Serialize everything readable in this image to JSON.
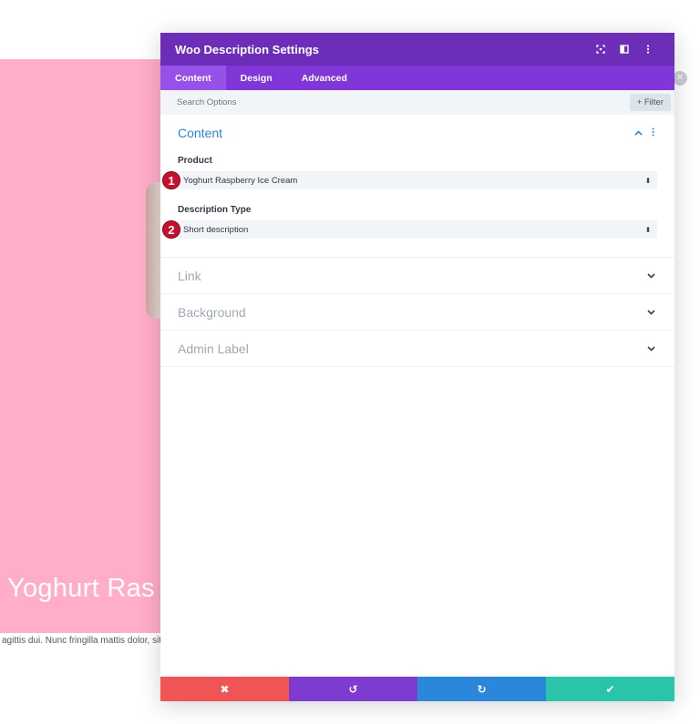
{
  "background": {
    "title": "Yoghurt Ras",
    "text": "agittis dui. Nunc fringilla mattis dolor, sit"
  },
  "modal": {
    "title": "Woo Description Settings",
    "header_icons": [
      "fullscreen-icon",
      "columns-icon",
      "kebab-icon"
    ]
  },
  "tabs": [
    {
      "label": "Content",
      "active": true
    },
    {
      "label": "Design",
      "active": false
    },
    {
      "label": "Advanced",
      "active": false
    }
  ],
  "search": {
    "placeholder": "Search Options",
    "filter_label": "+ Filter"
  },
  "content_section": {
    "title": "Content",
    "fields": [
      {
        "badge": "1",
        "label": "Product",
        "value": "Yoghurt Raspberry Ice Cream"
      },
      {
        "badge": "2",
        "label": "Description Type",
        "value": "Short description"
      }
    ]
  },
  "collapsed_sections": [
    "Link",
    "Background",
    "Admin Label"
  ],
  "footer": {
    "buttons": [
      {
        "name": "discard",
        "icon": "✖",
        "color": "#ef5555"
      },
      {
        "name": "undo",
        "icon": "↺",
        "color": "#7e3bd0"
      },
      {
        "name": "redo",
        "icon": "↻",
        "color": "#2b87da"
      },
      {
        "name": "save",
        "icon": "✔",
        "color": "#29c4a9"
      }
    ]
  },
  "colors": {
    "header": "#6c2eb9",
    "tabs": "#8137d8",
    "accent": "#2b87da",
    "page_pink": "#ffadc9",
    "badge": "#c8102e"
  }
}
